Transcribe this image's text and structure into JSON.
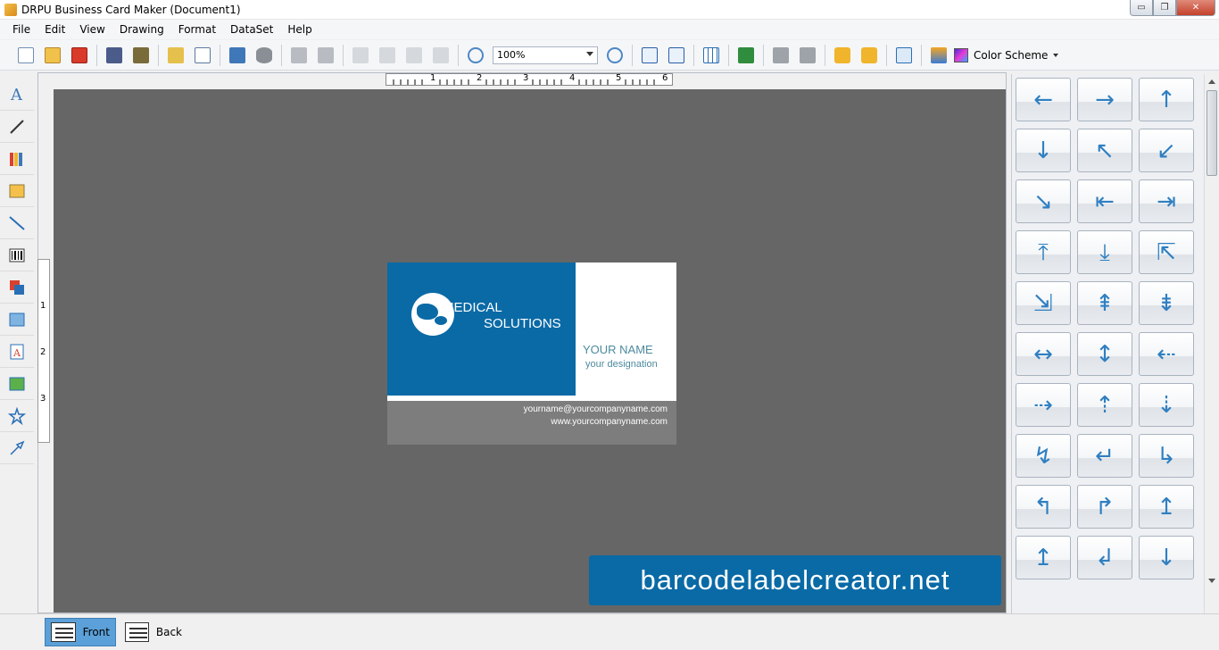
{
  "window": {
    "title": "DRPU Business Card Maker (Document1)",
    "min_glyph": "▭",
    "max_glyph": "❐",
    "close_glyph": "✕"
  },
  "menu": [
    "File",
    "Edit",
    "View",
    "Drawing",
    "Format",
    "DataSet",
    "Help"
  ],
  "toolbar": {
    "zoom_value": "100%",
    "color_scheme_label": "Color Scheme"
  },
  "ruler": {
    "h_ticks": [
      "1",
      "2",
      "3",
      "4",
      "5",
      "6"
    ],
    "v_ticks": [
      "1",
      "2",
      "3"
    ]
  },
  "card": {
    "logo_line1": "MEDICAL",
    "logo_line2": "SOLUTIONS",
    "name": "YOUR NAME",
    "designation": "your designation",
    "email": "yourname@yourcompanyname.com",
    "website": "www.yourcompanyname.com",
    "colors": {
      "primary": "#0a6aa6",
      "footer": "#7d7d7d",
      "text_accent": "#4c8a9e"
    }
  },
  "watermark": "barcodelabelcreator.net",
  "shapes": [
    "←",
    "→",
    "↑",
    "↓",
    "↖",
    "↙",
    "↘",
    "⇤",
    "⇥",
    "⤒",
    "⤓",
    "⇱",
    "⇲",
    "⇞",
    "⇟",
    "↔",
    "↕",
    "⇠",
    "⇢",
    "⇡",
    "⇣",
    "↯",
    "↵",
    "↳",
    "↰",
    "↱",
    "↥",
    "↥",
    "↲",
    "↓"
  ],
  "tabs": {
    "front": "Front",
    "back": "Back"
  }
}
